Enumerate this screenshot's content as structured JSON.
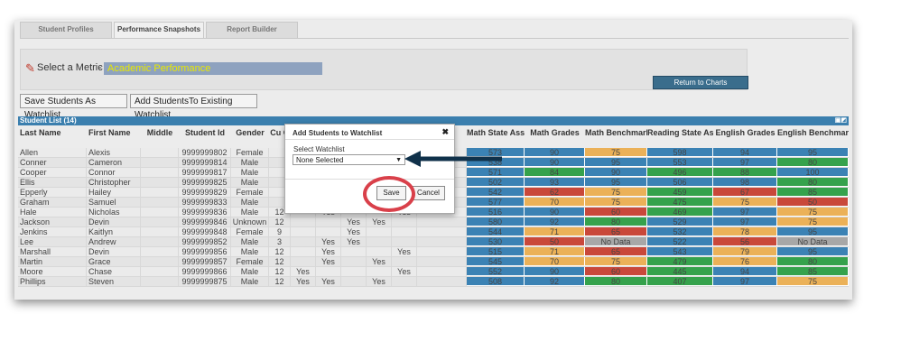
{
  "tabs": [
    "Student Profiles",
    "Performance Snapshots",
    "Report Builder"
  ],
  "metric": {
    "label": "Select a Metric",
    "value": "Academic Performance"
  },
  "return_button": "Return to Charts",
  "watchlist_buttons": {
    "save": "Save Students As Watchlist",
    "add": "Add StudentsTo Existing Watchlist"
  },
  "list_header": "Student List (14)",
  "columns": [
    "Last Name",
    "First Name",
    "Middle",
    "Student Id",
    "Gender",
    "Cu G",
    "",
    "",
    "",
    "",
    "",
    "ed",
    "Math State Assessments",
    "Math Grades",
    "Math Benchmarks",
    "Reading State Assessments",
    "English Grades",
    "English Benchmarks"
  ],
  "rows": [
    {
      "last": "Allen",
      "first": "Alexis",
      "id": "9999999802",
      "gender": "Female",
      "g": "",
      "f": [
        "",
        "",
        "",
        "",
        ""
      ],
      "s": [
        [
          "573",
          "blue"
        ],
        [
          "90",
          "blue"
        ],
        [
          "75",
          "orange"
        ],
        [
          "598",
          "blue"
        ],
        [
          "94",
          "blue"
        ],
        [
          "95",
          "blue"
        ]
      ]
    },
    {
      "last": "Conner",
      "first": "Cameron",
      "id": "9999999814",
      "gender": "Male",
      "g": "",
      "f": [
        "",
        "",
        "",
        "",
        ""
      ],
      "s": [
        [
          "538",
          "blue"
        ],
        [
          "90",
          "blue"
        ],
        [
          "95",
          "blue"
        ],
        [
          "553",
          "blue"
        ],
        [
          "97",
          "blue"
        ],
        [
          "80",
          "green"
        ]
      ]
    },
    {
      "last": "Cooper",
      "first": "Connor",
      "id": "9999999817",
      "gender": "Male",
      "g": "",
      "f": [
        "",
        "",
        "",
        "",
        ""
      ],
      "s": [
        [
          "571",
          "blue"
        ],
        [
          "84",
          "green"
        ],
        [
          "90",
          "blue"
        ],
        [
          "496",
          "green"
        ],
        [
          "88",
          "green"
        ],
        [
          "100",
          "blue"
        ]
      ]
    },
    {
      "last": "Ellis",
      "first": "Christopher",
      "id": "9999999825",
      "gender": "Male",
      "g": "",
      "f": [
        "",
        "",
        "",
        "",
        ""
      ],
      "s": [
        [
          "502",
          "blue"
        ],
        [
          "93",
          "blue"
        ],
        [
          "95",
          "blue"
        ],
        [
          "506",
          "blue"
        ],
        [
          "98",
          "blue"
        ],
        [
          "80",
          "green"
        ]
      ]
    },
    {
      "last": "Epperly",
      "first": "Hailey",
      "id": "9999999829",
      "gender": "Female",
      "g": "",
      "f": [
        "",
        "",
        "",
        "",
        ""
      ],
      "s": [
        [
          "542",
          "blue"
        ],
        [
          "62",
          "red"
        ],
        [
          "75",
          "orange"
        ],
        [
          "459",
          "green"
        ],
        [
          "67",
          "red"
        ],
        [
          "85",
          "green"
        ]
      ]
    },
    {
      "last": "Graham",
      "first": "Samuel",
      "id": "9999999833",
      "gender": "Male",
      "g": "",
      "f": [
        "",
        "",
        "",
        "",
        ""
      ],
      "s": [
        [
          "577",
          "blue"
        ],
        [
          "70",
          "orange"
        ],
        [
          "75",
          "orange"
        ],
        [
          "475",
          "green"
        ],
        [
          "75",
          "orange"
        ],
        [
          "50",
          "red"
        ]
      ]
    },
    {
      "last": "Hale",
      "first": "Nicholas",
      "id": "9999999836",
      "gender": "Male",
      "g": "12",
      "f": [
        "",
        "Yes",
        "",
        "",
        "Yes"
      ],
      "s": [
        [
          "516",
          "blue"
        ],
        [
          "90",
          "blue"
        ],
        [
          "60",
          "red"
        ],
        [
          "469",
          "green"
        ],
        [
          "97",
          "blue"
        ],
        [
          "75",
          "orange"
        ]
      ]
    },
    {
      "last": "Jackson",
      "first": "Devin",
      "id": "9999999846",
      "gender": "Unknown",
      "g": "12",
      "f": [
        "",
        "",
        "Yes",
        "Yes",
        ""
      ],
      "s": [
        [
          "580",
          "blue"
        ],
        [
          "92",
          "blue"
        ],
        [
          "80",
          "green"
        ],
        [
          "529",
          "blue"
        ],
        [
          "97",
          "blue"
        ],
        [
          "75",
          "orange"
        ]
      ]
    },
    {
      "last": "Jenkins",
      "first": "Kaitlyn",
      "id": "9999999848",
      "gender": "Female",
      "g": "9",
      "f": [
        "",
        "",
        "Yes",
        "",
        ""
      ],
      "s": [
        [
          "544",
          "blue"
        ],
        [
          "71",
          "orange"
        ],
        [
          "65",
          "red"
        ],
        [
          "532",
          "blue"
        ],
        [
          "78",
          "orange"
        ],
        [
          "95",
          "blue"
        ]
      ]
    },
    {
      "last": "Lee",
      "first": "Andrew",
      "id": "9999999852",
      "gender": "Male",
      "g": "3",
      "f": [
        "",
        "Yes",
        "Yes",
        "",
        ""
      ],
      "s": [
        [
          "530",
          "blue"
        ],
        [
          "50",
          "red"
        ],
        [
          "No Data",
          "gray"
        ],
        [
          "522",
          "blue"
        ],
        [
          "56",
          "red"
        ],
        [
          "No Data",
          "gray"
        ]
      ]
    },
    {
      "last": "Marshall",
      "first": "Devin",
      "id": "9999999856",
      "gender": "Male",
      "g": "12",
      "f": [
        "",
        "Yes",
        "",
        "",
        "Yes"
      ],
      "s": [
        [
          "515",
          "blue"
        ],
        [
          "71",
          "orange"
        ],
        [
          "65",
          "red"
        ],
        [
          "543",
          "blue"
        ],
        [
          "79",
          "orange"
        ],
        [
          "95",
          "blue"
        ]
      ]
    },
    {
      "last": "Martin",
      "first": "Grace",
      "id": "9999999857",
      "gender": "Female",
      "g": "12",
      "f": [
        "",
        "Yes",
        "",
        "Yes",
        ""
      ],
      "s": [
        [
          "545",
          "blue"
        ],
        [
          "70",
          "orange"
        ],
        [
          "75",
          "orange"
        ],
        [
          "479",
          "green"
        ],
        [
          "76",
          "orange"
        ],
        [
          "80",
          "green"
        ]
      ]
    },
    {
      "last": "Moore",
      "first": "Chase",
      "id": "9999999866",
      "gender": "Male",
      "g": "12",
      "f": [
        "Yes",
        "",
        "",
        "",
        "Yes"
      ],
      "s": [
        [
          "552",
          "blue"
        ],
        [
          "90",
          "blue"
        ],
        [
          "60",
          "red"
        ],
        [
          "445",
          "green"
        ],
        [
          "94",
          "blue"
        ],
        [
          "85",
          "green"
        ]
      ]
    },
    {
      "last": "Phillips",
      "first": "Steven",
      "id": "9999999875",
      "gender": "Male",
      "g": "12",
      "f": [
        "Yes",
        "Yes",
        "",
        "Yes",
        ""
      ],
      "s": [
        [
          "508",
          "blue"
        ],
        [
          "92",
          "blue"
        ],
        [
          "80",
          "green"
        ],
        [
          "407",
          "green"
        ],
        [
          "97",
          "blue"
        ],
        [
          "75",
          "orange"
        ]
      ]
    }
  ],
  "modal": {
    "title": "Add Students to Watchlist",
    "close": "✖",
    "select_label": "Select Watchlist",
    "select_value": "None Selected",
    "save": "Save",
    "cancel": "Cancel"
  },
  "colors": {
    "blue": "#3b82b4",
    "green": "#35a24c",
    "orange": "#ebb158",
    "red": "#c9483a",
    "gray": "#a7a7a7",
    "header": "#3b7fae"
  }
}
